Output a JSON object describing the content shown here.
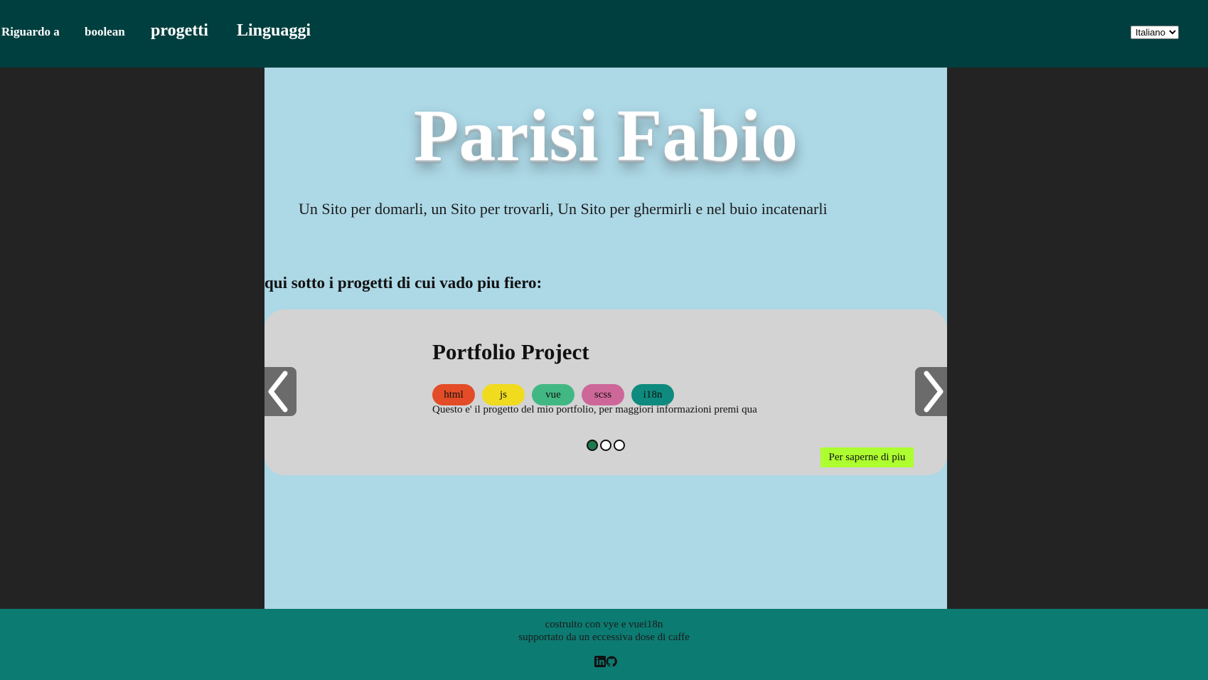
{
  "nav": {
    "about": "Riguardo a",
    "boolean": "boolean",
    "projects": "progetti",
    "languages": "Linguaggi"
  },
  "language_select": {
    "selected": "Italiano"
  },
  "hero": {
    "title": "Parisi Fabio",
    "tagline": "Un Sito per domarli, un Sito per trovarli, Un Sito per ghermirli e nel buio incatenarli"
  },
  "projects": {
    "heading": "qui sotto i progetti di cui vado piu fiero:"
  },
  "carousel": {
    "slide": {
      "title": "Portfolio Project",
      "tags": [
        {
          "label": "html",
          "color": "#e34c26"
        },
        {
          "label": "js",
          "color": "#f0db1e"
        },
        {
          "label": "vue",
          "color": "#41b883"
        },
        {
          "label": "scss",
          "color": "#cd6799"
        },
        {
          "label": "i18n",
          "color": "#0e8a7e"
        }
      ],
      "description": "Questo e' il progetto del mio portfolio, per maggiori informazioni premi qua"
    },
    "dots_total": 3,
    "dots_active_index": 0,
    "more_label": "Per saperne di piu",
    "prev_icon": "chevron-left-icon",
    "next_icon": "chevron-right-icon"
  },
  "footer": {
    "line1": "costruito con vye e vuei18n",
    "line2": "supportato da un eccessiva dose di caffe",
    "icons": [
      "linkedin-icon",
      "github-icon"
    ]
  },
  "colors": {
    "header_bg": "#003f3f",
    "page_bg": "#232323",
    "main_bg": "#add8e6",
    "carousel_bg": "#d3d3d3",
    "footer_bg": "#0c7b72",
    "accent_button": "#adff2f",
    "active_dot": "#1d7a4e"
  }
}
